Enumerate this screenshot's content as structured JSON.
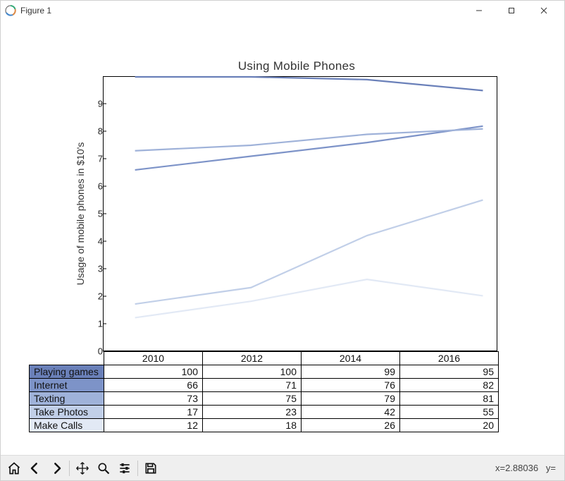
{
  "window": {
    "title": "Figure 1"
  },
  "chart_data": {
    "type": "line",
    "title": "Using Mobile Phones",
    "xlabel": "",
    "ylabel": "Usage of mobile phones in $10's",
    "categories": [
      "2010",
      "2012",
      "2014",
      "2016"
    ],
    "yticks": [
      0,
      1,
      2,
      3,
      4,
      5,
      6,
      7,
      8,
      9
    ],
    "ylim": [
      0,
      10
    ],
    "series": [
      {
        "name": "Playing games",
        "values": [
          100,
          100,
          99,
          95
        ],
        "color": "#6a80b9"
      },
      {
        "name": "Internet",
        "values": [
          66,
          71,
          76,
          82
        ],
        "color": "#7d93c8"
      },
      {
        "name": "Texting",
        "values": [
          73,
          75,
          79,
          81
        ],
        "color": "#9fb2d9"
      },
      {
        "name": "Take Photos",
        "values": [
          17,
          23,
          42,
          55
        ],
        "color": "#c1cfe8"
      },
      {
        "name": "Make Calls",
        "values": [
          12,
          18,
          26,
          20
        ],
        "color": "#e2e9f5"
      }
    ]
  },
  "toolbar": {
    "home": "Home",
    "back": "Back",
    "forward": "Forward",
    "pan": "Pan",
    "zoom": "Zoom",
    "configure": "Configure subplots",
    "save": "Save"
  },
  "status": {
    "x_label": "x=",
    "x_value": "2.88036",
    "y_label": "y="
  }
}
